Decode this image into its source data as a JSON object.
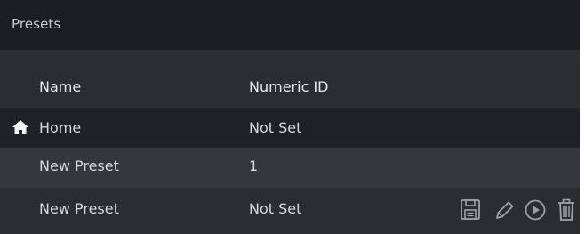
{
  "panel": {
    "title": "Presets"
  },
  "table": {
    "columns": [
      "Name",
      "Numeric ID"
    ],
    "rows": [
      {
        "name": "Home",
        "numeric_id": "Not Set",
        "icon": "home-icon"
      },
      {
        "name": "New Preset",
        "numeric_id": "1"
      },
      {
        "name": "New Preset",
        "numeric_id": "Not Set"
      }
    ]
  },
  "row_actions": [
    {
      "icon": "save-icon"
    },
    {
      "icon": "pencil-icon"
    },
    {
      "icon": "play-circle-icon"
    },
    {
      "icon": "trash-icon"
    }
  ],
  "colors": {
    "background": "#1f2126",
    "header_row": "#2a2d33",
    "highlight_row": "#34373d",
    "text": "#d6d8dc",
    "icon": "#9ea2a8"
  }
}
